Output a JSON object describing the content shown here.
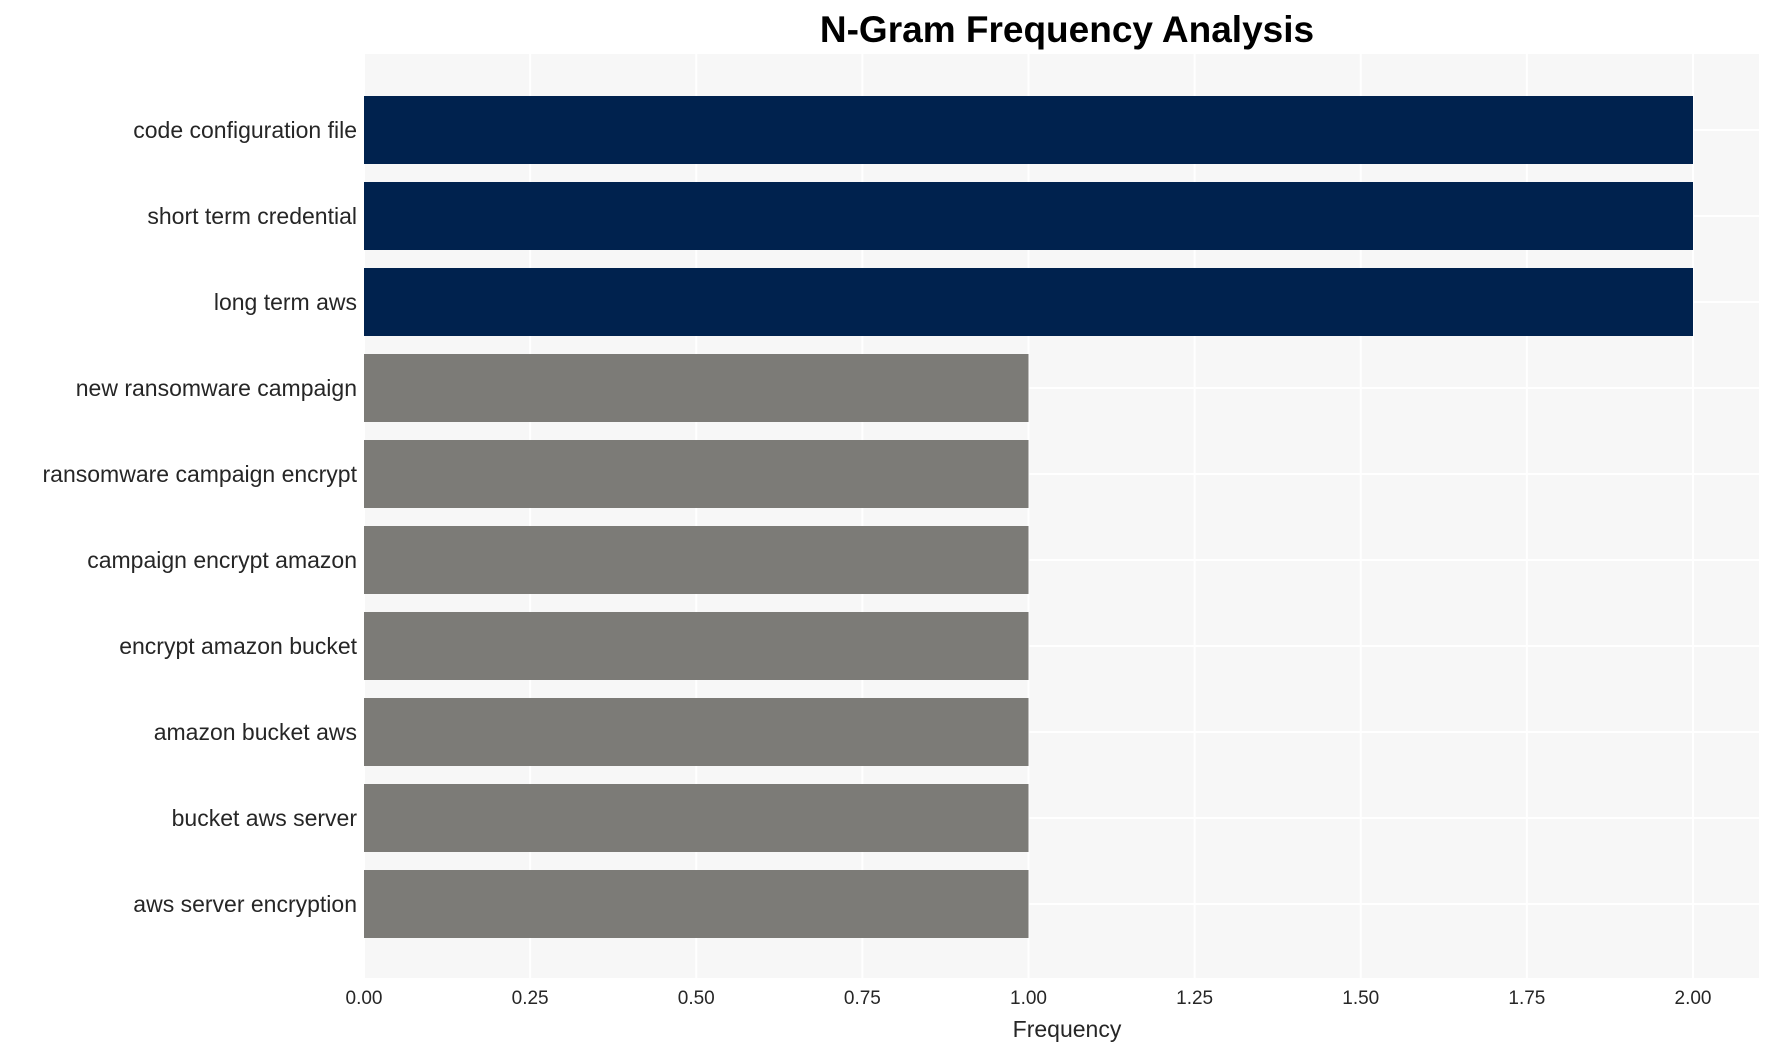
{
  "chart_data": {
    "type": "bar",
    "orientation": "horizontal",
    "title": "N-Gram Frequency Analysis",
    "xlabel": "Frequency",
    "ylabel": "",
    "xlim": [
      0,
      2.1
    ],
    "xticks": [
      0.0,
      0.25,
      0.5,
      0.75,
      1.0,
      1.25,
      1.5,
      1.75,
      2.0
    ],
    "xtick_labels": [
      "0.00",
      "0.25",
      "0.50",
      "0.75",
      "1.00",
      "1.25",
      "1.50",
      "1.75",
      "2.00"
    ],
    "grid": true,
    "categories": [
      "code configuration file",
      "short term credential",
      "long term aws",
      "new ransomware campaign",
      "ransomware campaign encrypt",
      "campaign encrypt amazon",
      "encrypt amazon bucket",
      "amazon bucket aws",
      "bucket aws server",
      "aws server encryption"
    ],
    "values": [
      2,
      2,
      2,
      1,
      1,
      1,
      1,
      1,
      1,
      1
    ],
    "colors": {
      "highlight": "#00224e",
      "default": "#7c7b77",
      "plot_background": "#f7f7f7",
      "grid": "#ffffff"
    }
  }
}
